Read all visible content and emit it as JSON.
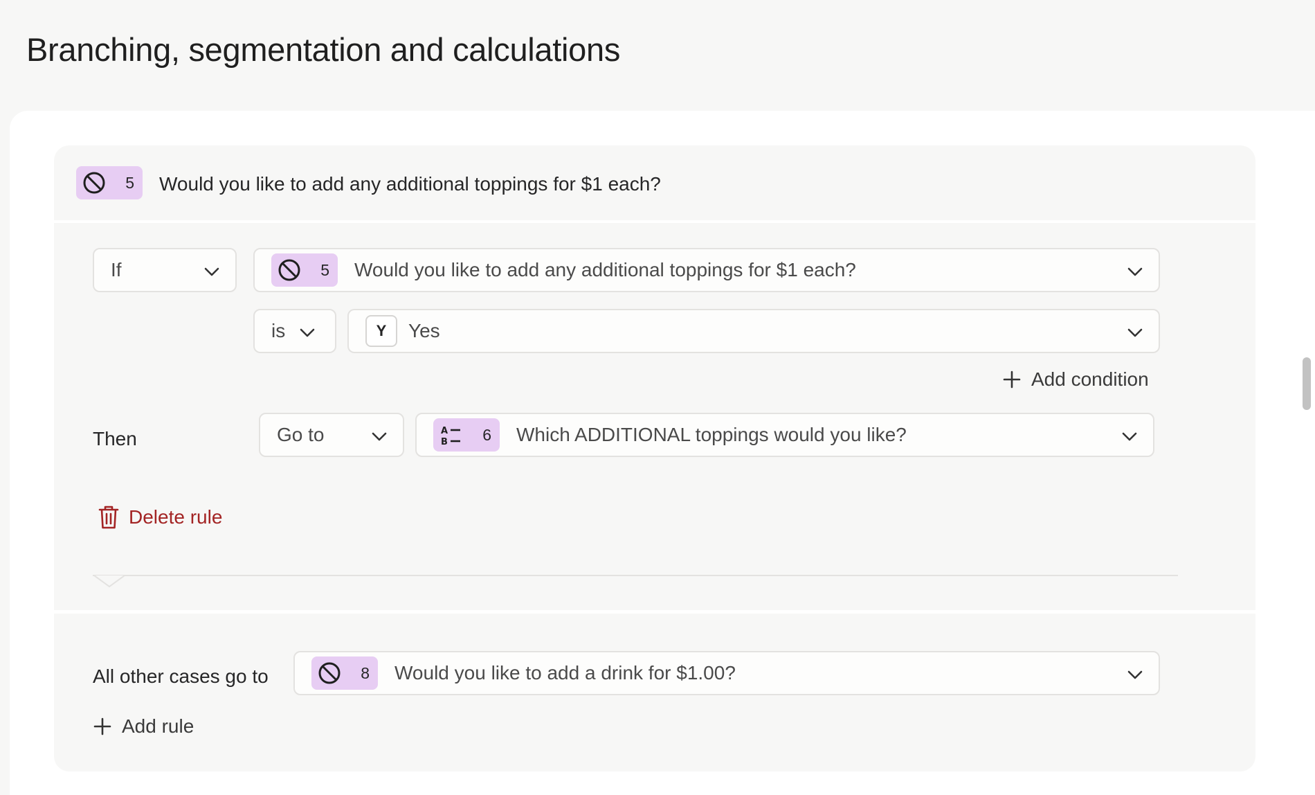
{
  "page": {
    "title": "Branching, segmentation and calculations"
  },
  "question": {
    "icon": "no-entry-icon",
    "number": "5",
    "text": "Would you like to add any additional toppings for $1 each?"
  },
  "rule": {
    "operator": "If",
    "condition": {
      "question_icon": "no-entry-icon",
      "question_number": "5",
      "question_text": "Would you like to add any additional toppings for $1 each?",
      "comparator": "is",
      "value_key": "Y",
      "value_label": "Yes"
    },
    "add_condition_label": "Add condition",
    "then_label": "Then",
    "action": "Go to",
    "target": {
      "icon": "multiple-choice-icon",
      "number": "6",
      "text": "Which ADDITIONAL toppings would you like?"
    },
    "delete_label": "Delete rule"
  },
  "fallback": {
    "label": "All other cases go to",
    "target": {
      "icon": "no-entry-icon",
      "number": "8",
      "text": "Would you like to add a drink for $1.00?"
    },
    "add_rule_label": "Add rule"
  },
  "colors": {
    "badge_bg": "#e7cdf3",
    "danger": "#a32424",
    "card_bg": "#f7f7f6"
  }
}
